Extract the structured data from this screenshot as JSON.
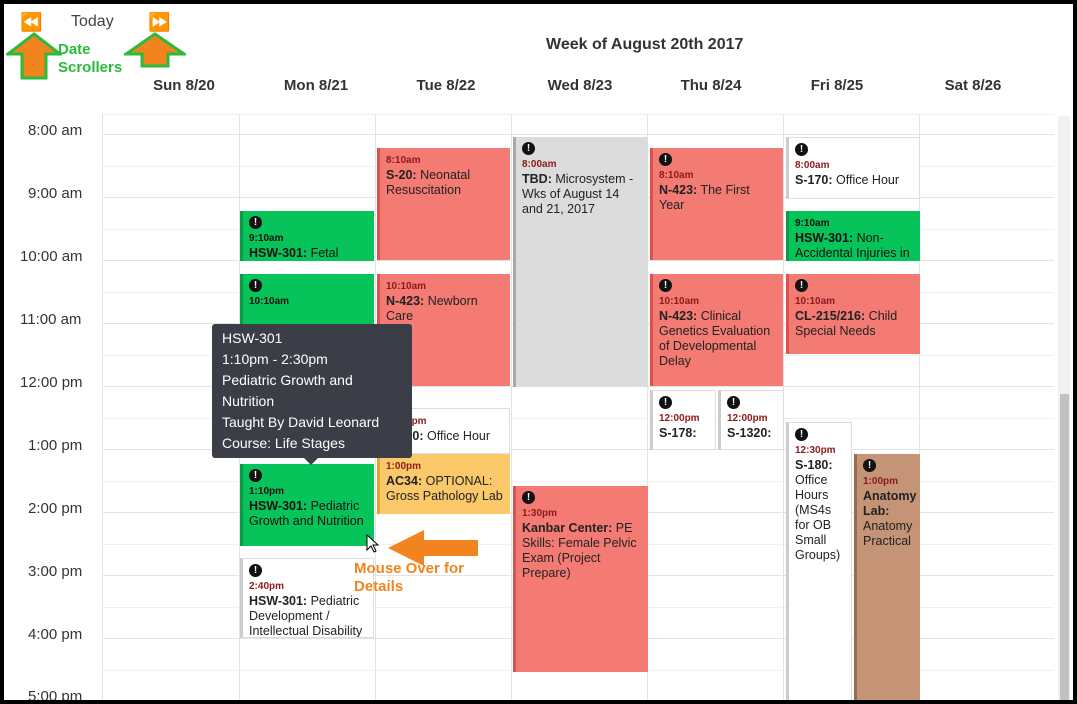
{
  "nav": {
    "prev": "⏪",
    "today": "Today",
    "next": "⏩"
  },
  "week_title": "Week of August 20th 2017",
  "days": [
    "Sun 8/20",
    "Mon 8/21",
    "Tue 8/22",
    "Wed 8/23",
    "Thu 8/24",
    "Fri 8/25",
    "Sat 8/26"
  ],
  "times": [
    "8:00 am",
    "9:00 am",
    "10:00 am",
    "11:00 am",
    "12:00 pm",
    "1:00 pm",
    "2:00 pm",
    "3:00 pm",
    "4:00 pm",
    "5:00 pm"
  ],
  "annotations": {
    "date_scrollers": "Date Scrollers",
    "mouse_over": "Mouse Over for Details"
  },
  "events": {
    "mon_910": {
      "time": "9:10am",
      "code": "HSW-301:",
      "title": "Fetal"
    },
    "mon_1010": {
      "time": "10:10am"
    },
    "mon_110": {
      "time": "1:10pm",
      "code": "HSW-301:",
      "title": "Pediatric Growth and Nutrition"
    },
    "mon_240": {
      "time": "2:40pm",
      "code": "HSW-301:",
      "title": "Pediatric Development / Intellectual Disability"
    },
    "tue_810": {
      "time": "8:10am",
      "code": "S-20:",
      "title": "Neonatal Resuscitation"
    },
    "tue_1010": {
      "time": "10:10am",
      "code": "N-423:",
      "title": "Newborn Care"
    },
    "tue_1210": {
      "time": "12:10pm",
      "code": "S-320:",
      "title": "Office Hour"
    },
    "tue_100": {
      "time": "1:00pm",
      "code": "AC34:",
      "title": "OPTIONAL: Gross Pathology Lab"
    },
    "wed_800": {
      "time": "8:00am",
      "code": "TBD:",
      "title": "Microsystem - Wks of August 14 and 21, 2017"
    },
    "wed_130": {
      "time": "1:30pm",
      "code": "Kanbar Center:",
      "title": "PE Skills: Female Pelvic Exam (Project Prepare)"
    },
    "thu_810": {
      "time": "8:10am",
      "code": "N-423:",
      "title": "The First Year"
    },
    "thu_1010": {
      "time": "10:10am",
      "code": "N-423:",
      "title": "Clinical Genetics Evaluation of Developmental Delay"
    },
    "thu_1200a": {
      "time": "12:00pm",
      "code": "S-178:",
      "title": ""
    },
    "thu_1200b": {
      "time": "12:00pm",
      "code": "S-1320:",
      "title": ""
    },
    "fri_800": {
      "time": "8:00am",
      "code": "S-170:",
      "title": "Office Hour"
    },
    "fri_910": {
      "time": "9:10am",
      "code": "HSW-301:",
      "title": "Non-Accidental Injuries in"
    },
    "fri_1010": {
      "time": "10:10am",
      "code": "CL-215/216:",
      "title": "Child Special Needs"
    },
    "fri_1230": {
      "time": "12:30pm",
      "code": "S-180:",
      "title": "Office Hours (MS4s for OB Small Groups)"
    },
    "fri_100": {
      "time": "1:00pm",
      "code": "Anatomy Lab:",
      "title": "Anatomy Practical"
    }
  },
  "tooltip": {
    "course_code": "HSW-301",
    "time_range": "1:10pm - 2:30pm",
    "title": "Pediatric Growth and Nutrition",
    "instructor": "Taught By David Leonard",
    "course": "Course: Life Stages"
  },
  "colors": {
    "green": "#06c45a",
    "red": "#f47a74",
    "gray": "#dcdcdc",
    "orange": "#fbc86a",
    "brown": "#c59376",
    "arrow_orange": "#f2841f"
  }
}
